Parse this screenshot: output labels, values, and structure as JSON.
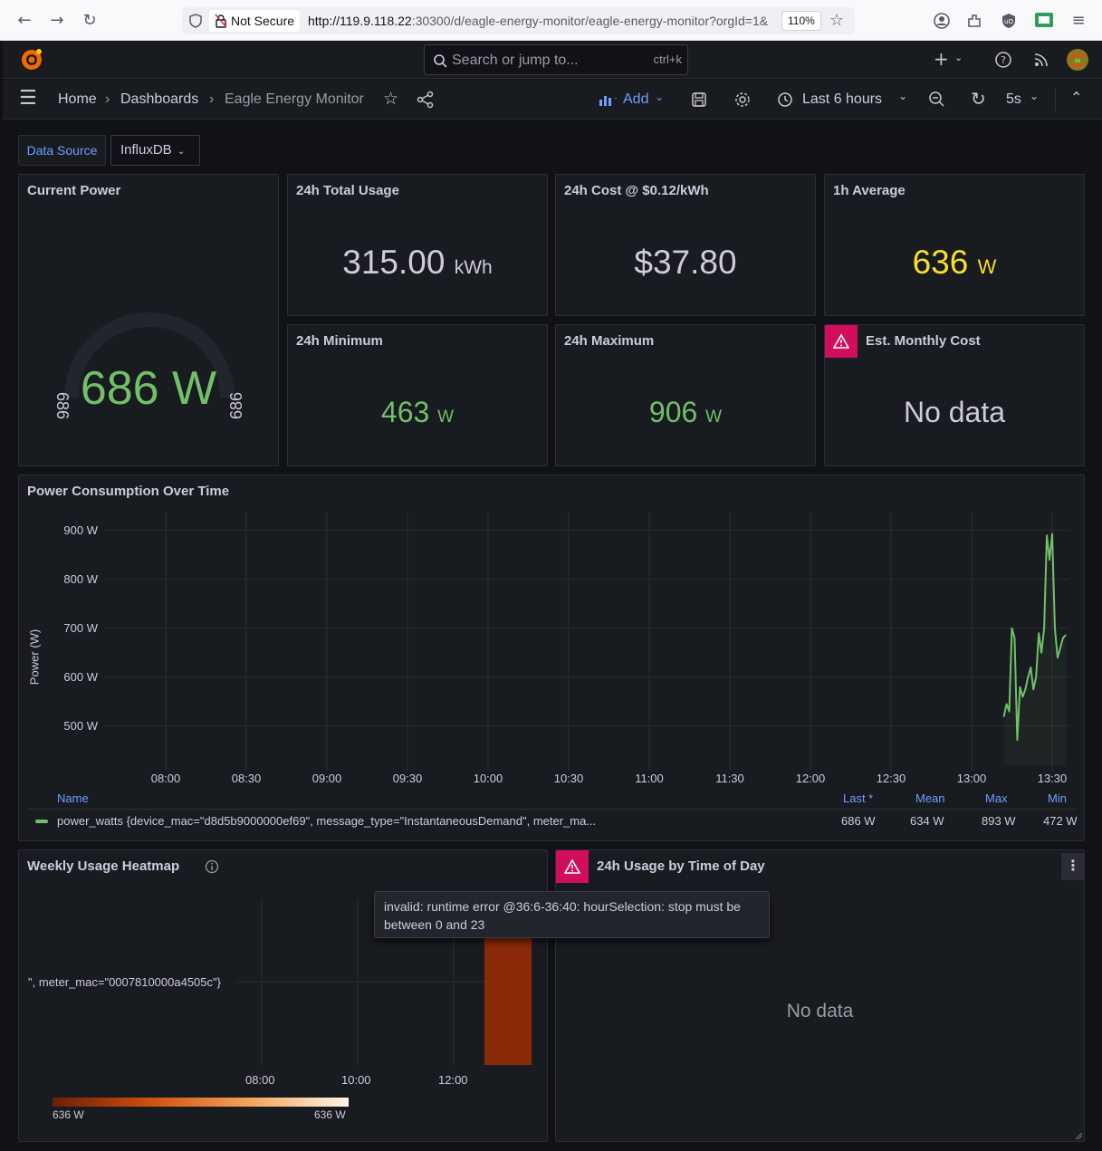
{
  "browser": {
    "not_secure_label": "Not Secure",
    "url_host": "http://119.9.118.22",
    "url_rest": ":30300/d/eagle-energy-monitor/eagle-energy-monitor?orgId=1&",
    "zoom": "110%"
  },
  "topbar": {
    "search_placeholder": "Search or jump to...",
    "search_shortcut": "ctrl+k"
  },
  "breadcrumb": {
    "home": "Home",
    "dashboards": "Dashboards",
    "current": "Eagle Energy Monitor"
  },
  "toolbar": {
    "add_label": "Add",
    "time_range": "Last 6 hours",
    "refresh_interval": "5s"
  },
  "variables": {
    "datasource_label": "Data Source",
    "datasource_value": "InfluxDB"
  },
  "colors": {
    "green": "#73bf69",
    "yellow": "#fade2a",
    "error": "#d10e5c",
    "link_blue": "#6e9fff"
  },
  "panels": {
    "current_power": {
      "title": "Current Power",
      "value": "686 W",
      "gauge_min": "686",
      "gauge_max": "686",
      "gauge_fraction": 0.0
    },
    "total_usage": {
      "title": "24h Total Usage",
      "value": "315.00",
      "unit": "kWh"
    },
    "cost": {
      "title": "24h Cost @ $0.12/kWh",
      "value": "$37.80"
    },
    "avg_1h": {
      "title": "1h Average",
      "value": "636",
      "unit": "W"
    },
    "min_24h": {
      "title": "24h Minimum",
      "value": "463",
      "unit": "W"
    },
    "max_24h": {
      "title": "24h Maximum",
      "value": "906",
      "unit": "W"
    },
    "monthly_cost": {
      "title": "Est. Monthly Cost",
      "value": "No data"
    },
    "power_over_time": {
      "title": "Power Consumption Over Time",
      "legend": {
        "headers": {
          "name": "Name",
          "last": "Last *",
          "mean": "Mean",
          "max": "Max",
          "min": "Min"
        },
        "series_name": "power_watts {device_mac=\"d8d5b9000000ef69\", message_type=\"InstantaneousDemand\", meter_ma...",
        "last": "686 W",
        "mean": "634 W",
        "max": "893 W",
        "min": "472 W"
      }
    },
    "heatmap": {
      "title": "Weekly Usage Heatmap",
      "row_label": "\", meter_mac=\"0007810000a4505c\"}",
      "x_ticks": [
        "08:00",
        "10:00",
        "12:00"
      ],
      "scale_min": "636 W",
      "scale_max": "636 W"
    },
    "time_of_day": {
      "title": "24h Usage by Time of Day",
      "value": "No data",
      "error_tooltip": "invalid: runtime error @36:6-36:40: hourSelection: stop must be between 0 and 23"
    }
  },
  "chart_data": {
    "type": "line",
    "ylabel": "Power (W)",
    "x_ticks": [
      "08:00",
      "08:30",
      "09:00",
      "09:30",
      "10:00",
      "10:30",
      "11:00",
      "11:30",
      "12:00",
      "12:30",
      "13:00",
      "13:30"
    ],
    "y_ticks": [
      "500 W",
      "600 W",
      "700 W",
      "800 W",
      "900 W"
    ],
    "ylim": [
      420,
      920
    ],
    "grid": true,
    "series": [
      {
        "name": "power_watts {device_mac=\"d8d5b9000000ef69\", message_type=\"InstantaneousDemand\", meter_ma...",
        "color": "#73bf69",
        "x": [
          "13:12",
          "13:13",
          "13:14",
          "13:15",
          "13:16",
          "13:17",
          "13:18",
          "13:19",
          "13:20",
          "13:21",
          "13:22",
          "13:23",
          "13:24",
          "13:25",
          "13:26",
          "13:27",
          "13:28",
          "13:29",
          "13:30",
          "13:31",
          "13:32",
          "13:33",
          "13:34",
          "13:35"
        ],
        "y": [
          520,
          545,
          530,
          700,
          680,
          472,
          580,
          560,
          575,
          600,
          620,
          575,
          600,
          690,
          650,
          700,
          890,
          840,
          893,
          700,
          640,
          660,
          680,
          686
        ]
      }
    ]
  }
}
